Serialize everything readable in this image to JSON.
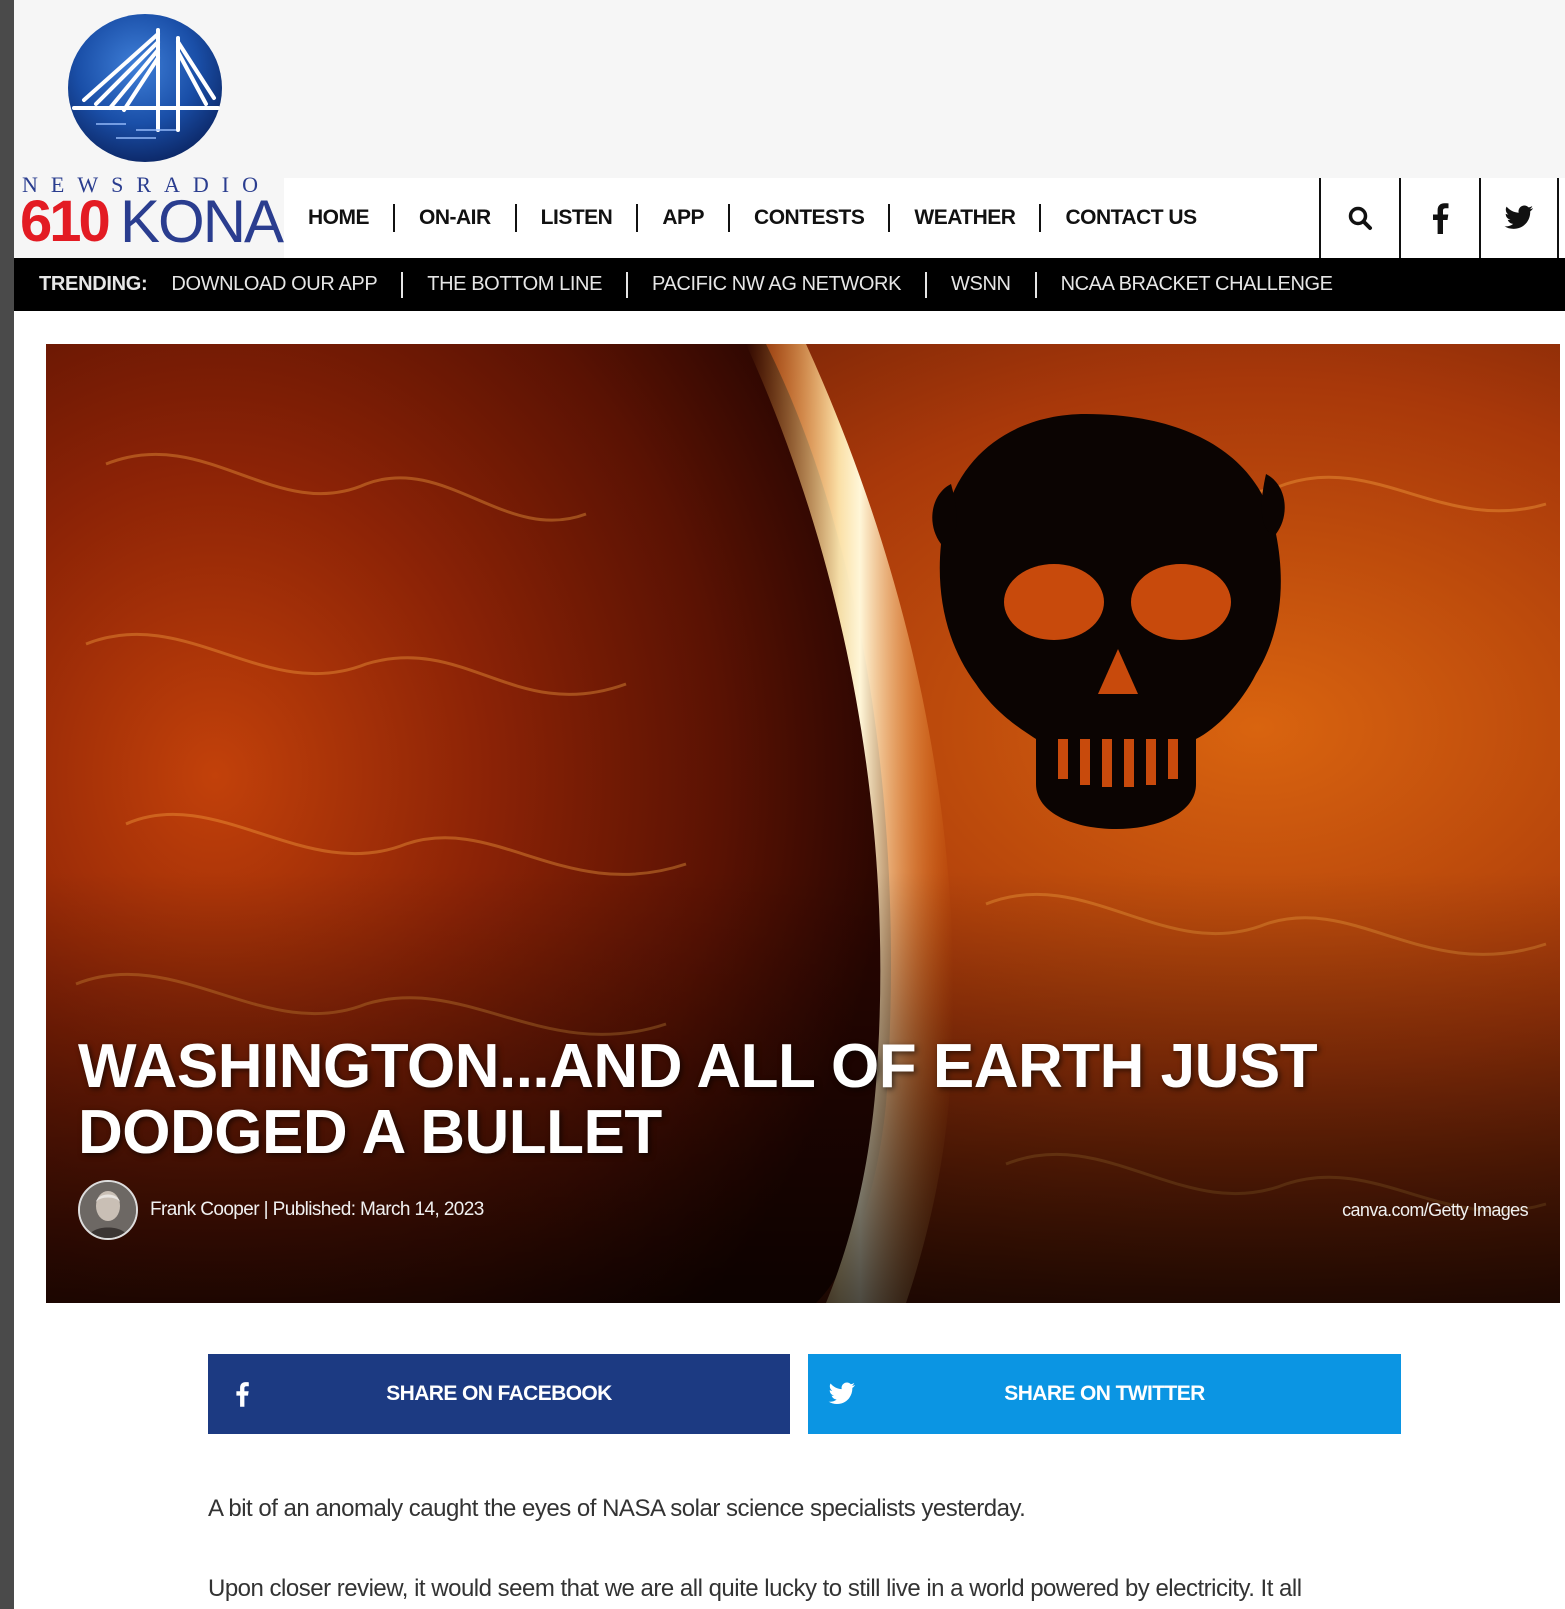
{
  "brand": {
    "tagline": "NEWSRADIO",
    "number": "610",
    "name": "KONA"
  },
  "nav": {
    "items": [
      "HOME",
      "ON-AIR",
      "LISTEN",
      "APP",
      "CONTESTS",
      "WEATHER",
      "CONTACT US"
    ],
    "icons": [
      "search-icon",
      "facebook-icon",
      "twitter-icon"
    ]
  },
  "trending": {
    "label": "TRENDING:",
    "items": [
      "DOWNLOAD OUR APP",
      "THE BOTTOM LINE",
      "PACIFIC NW AG NETWORK",
      "WSNN",
      "NCAA BRACKET CHALLENGE"
    ]
  },
  "article": {
    "title": "WASHINGTON...AND ALL OF EARTH JUST DODGED A BULLET",
    "byline": "Frank Cooper | Published: March 14, 2023",
    "image_credit": "canva.com/Getty Images",
    "share_facebook": "SHARE ON FACEBOOK",
    "share_twitter": "SHARE ON TWITTER",
    "paragraphs": [
      "A bit of an anomaly caught the eyes of NASA solar science specialists yesterday.",
      "Upon closer review, it would seem that we are all quite lucky to still live in a world powered by electricity. It all"
    ]
  },
  "colors": {
    "brand_red": "#e31b23",
    "brand_blue": "#2a3d8f",
    "facebook_blue": "#1c3a82",
    "twitter_blue": "#0b95e3"
  }
}
